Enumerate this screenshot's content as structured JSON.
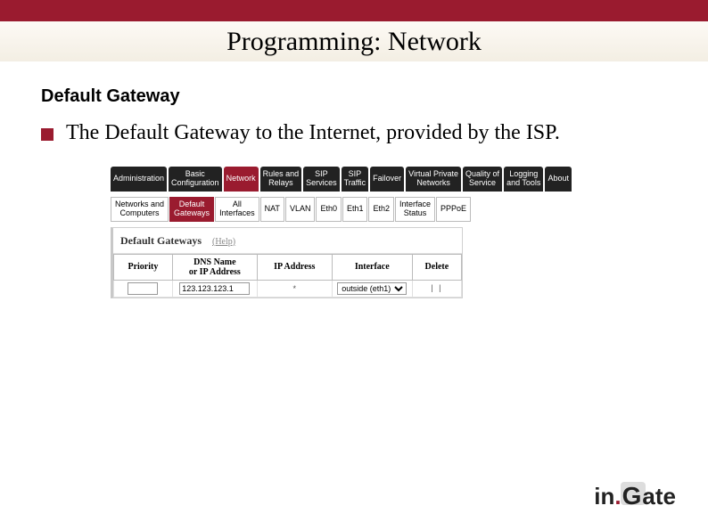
{
  "slide": {
    "title": "Programming: Network",
    "section_title": "Default Gateway",
    "bullet": "The Default Gateway to the Internet, provided by the ISP."
  },
  "main_tabs": [
    {
      "label": "Administration",
      "active": false
    },
    {
      "label": "Basic\nConfiguration",
      "active": false
    },
    {
      "label": "Network",
      "active": true
    },
    {
      "label": "Rules and\nRelays",
      "active": false
    },
    {
      "label": "SIP\nServices",
      "active": false
    },
    {
      "label": "SIP\nTraffic",
      "active": false
    },
    {
      "label": "Failover",
      "active": false
    },
    {
      "label": "Virtual Private\nNetworks",
      "active": false
    },
    {
      "label": "Quality of\nService",
      "active": false
    },
    {
      "label": "Logging\nand Tools",
      "active": false
    },
    {
      "label": "About",
      "active": false
    }
  ],
  "sub_tabs": [
    {
      "label": "Networks and\nComputers",
      "active": false
    },
    {
      "label": "Default\nGateways",
      "active": true
    },
    {
      "label": "All\nInterfaces",
      "active": false
    },
    {
      "label": "NAT",
      "active": false
    },
    {
      "label": "VLAN",
      "active": false
    },
    {
      "label": "Eth0",
      "active": false
    },
    {
      "label": "Eth1",
      "active": false
    },
    {
      "label": "Eth2",
      "active": false
    },
    {
      "label": "Interface\nStatus",
      "active": false
    },
    {
      "label": "PPPoE",
      "active": false
    }
  ],
  "panel": {
    "title": "Default Gateways",
    "help": "(Help)"
  },
  "table": {
    "headers": {
      "priority": "Priority",
      "dns": "DNS Name\nor IP Address",
      "ip": "IP Address",
      "iface": "Interface",
      "delete": "Delete"
    },
    "row": {
      "priority_value": "",
      "dns_value": "123.123.123.1",
      "ip_value": "*",
      "iface_value": "outside (eth1)",
      "delete_marks": "| |"
    }
  },
  "logo": {
    "in": "in",
    "dot": ".",
    "g": "G",
    "ate": "ate"
  }
}
